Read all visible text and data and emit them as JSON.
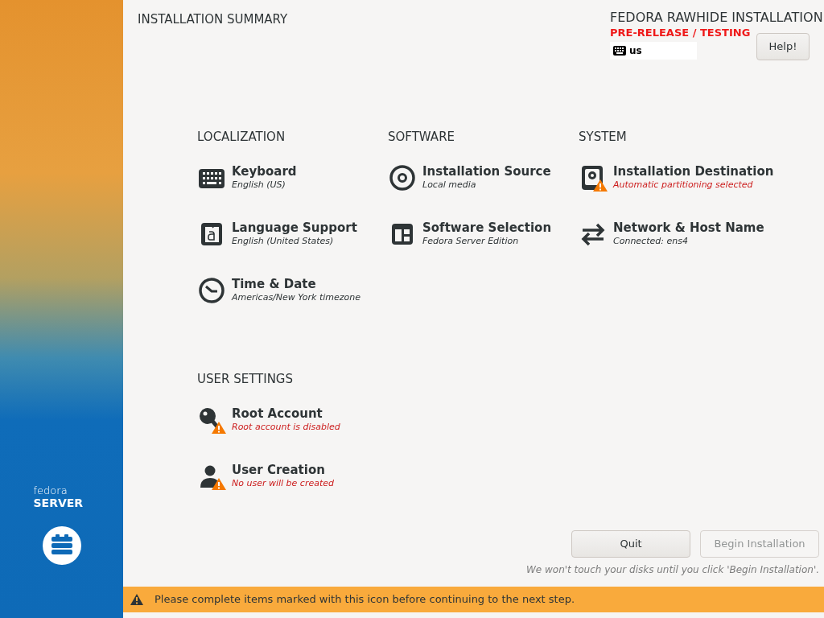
{
  "sidebar": {
    "brand_top": "fedora",
    "brand_bottom": "SERVER"
  },
  "header": {
    "title": "INSTALLATION SUMMARY",
    "product": "FEDORA RAWHIDE INSTALLATION",
    "prerelease": "PRE-RELEASE / TESTING",
    "keyboard_layout": "us",
    "help_button": "Help!"
  },
  "sections": [
    {
      "heading": "LOCALIZATION",
      "spokes": [
        {
          "kind": "keyboard",
          "title": "Keyboard",
          "status": "English (US)",
          "warning": false
        },
        {
          "kind": "language",
          "title": "Language Support",
          "status": "English (United States)",
          "warning": false
        },
        {
          "kind": "clock",
          "title": "Time & Date",
          "status": "Americas/New York timezone",
          "warning": false
        }
      ]
    },
    {
      "heading": "SOFTWARE",
      "spokes": [
        {
          "kind": "disc",
          "title": "Installation Source",
          "status": "Local media",
          "warning": false
        },
        {
          "kind": "package",
          "title": "Software Selection",
          "status": "Fedora Server Edition",
          "warning": false
        }
      ]
    },
    {
      "heading": "SYSTEM",
      "spokes": [
        {
          "kind": "disk",
          "title": "Installation Destination",
          "status": "Automatic partitioning selected",
          "warning": true
        },
        {
          "kind": "network",
          "title": "Network & Host Name",
          "status": "Connected: ens4",
          "warning": false
        }
      ]
    },
    {
      "heading": "USER SETTINGS",
      "spokes": [
        {
          "kind": "key",
          "title": "Root Account",
          "status": "Root account is disabled",
          "warning": true
        },
        {
          "kind": "user",
          "title": "User Creation",
          "status": "No user will be created",
          "warning": true
        }
      ]
    }
  ],
  "buttons": [
    {
      "label": "Quit",
      "disabled": false
    },
    {
      "label": "Begin Installation",
      "disabled": true
    }
  ],
  "note": "We won't touch your disks until you click 'Begin Installation'.",
  "warning_bar": "Please complete items marked with this icon before continuing to the next step."
}
